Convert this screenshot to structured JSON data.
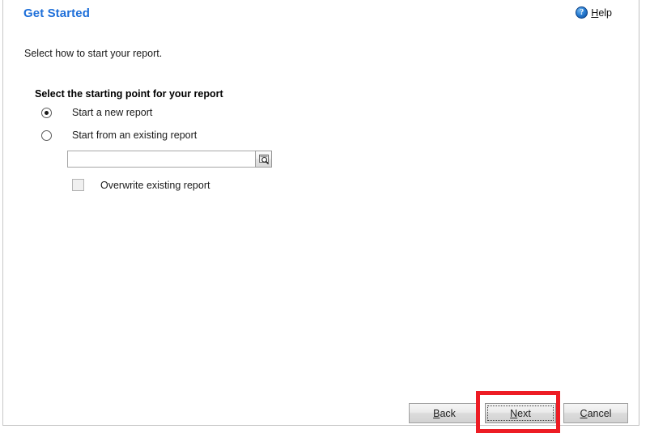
{
  "window": {
    "title": "Get Started",
    "title_color": "#1e6fd9",
    "background": "#ffffff"
  },
  "header": {
    "title": "Get Started",
    "help": {
      "label_accel": "H",
      "label_rest": "elp",
      "icon": "help-question-circle-icon",
      "icon_glyph": "?"
    }
  },
  "intro": {
    "text": "Select how to start your report."
  },
  "options_group": {
    "label": "Select the starting point for your report",
    "radios": [
      {
        "label": "Start a new report",
        "selected": true
      },
      {
        "label": "Start from an existing report",
        "selected": false
      }
    ],
    "path_field": {
      "value": "",
      "placeholder": "",
      "browse_icon": "browse-search-document-icon"
    },
    "checkbox": {
      "label": "Overwrite existing report",
      "checked": false
    }
  },
  "footer": {
    "buttons": [
      {
        "accel": "B",
        "rest": "ack",
        "name": "back",
        "state": "enabled"
      },
      {
        "accel": "N",
        "rest": "ext",
        "name": "next",
        "state": "focused"
      },
      {
        "accel": "C",
        "rest": "ancel",
        "name": "cancel",
        "state": "enabled"
      }
    ]
  },
  "annotation": {
    "highlight_target": "next-button",
    "color": "#ed1c24"
  }
}
